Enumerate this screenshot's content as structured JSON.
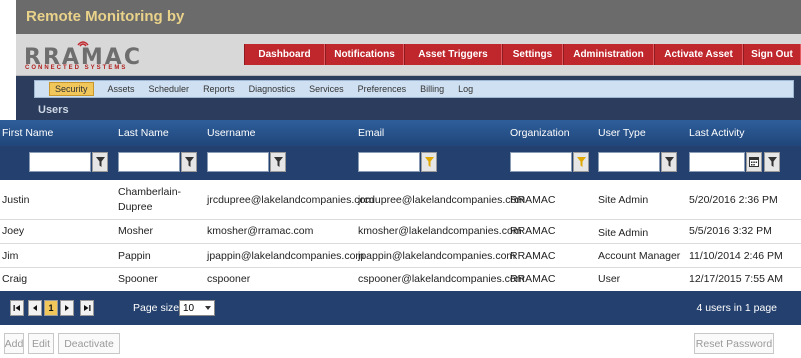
{
  "app": {
    "title": "Remote Monitoring by"
  },
  "logo": {
    "name": "RRAMAC",
    "tagline": "CONNECTED SYSTEMS"
  },
  "mainnav": [
    {
      "label": "Dashboard"
    },
    {
      "label": "Notifications"
    },
    {
      "label": "Asset Triggers"
    },
    {
      "label": "Settings"
    },
    {
      "label": "Administration"
    },
    {
      "label": "Activate Asset"
    },
    {
      "label": "Sign Out"
    }
  ],
  "subtabs": [
    {
      "label": "Security",
      "active": true
    },
    {
      "label": "Assets"
    },
    {
      "label": "Scheduler"
    },
    {
      "label": "Reports"
    },
    {
      "label": "Diagnostics"
    },
    {
      "label": "Services"
    },
    {
      "label": "Preferences"
    },
    {
      "label": "Billing"
    },
    {
      "label": "Log"
    }
  ],
  "section": {
    "title": "Users"
  },
  "grid": {
    "columns": [
      "First Name",
      "Last Name",
      "Username",
      "Email",
      "Organization",
      "User Type",
      "Last Activity"
    ],
    "rows": [
      {
        "first": "Justin",
        "last": "Chamberlain-Dupree",
        "username": "jrcdupree@lakelandcompanies.com",
        "email": "jrcdupree@lakelandcompanies.com",
        "org": "RRAMAC",
        "type": "Site Admin",
        "activity": "5/20/2016 2:36 PM"
      },
      {
        "first": "Joey",
        "last": "Mosher",
        "username": "kmosher@rramac.com",
        "email": "kmosher@lakelandcompanies.com",
        "org": "RRAMAC",
        "type": "Site Admin",
        "activity": "5/5/2016 3:32 PM"
      },
      {
        "first": "Jim",
        "last": "Pappin",
        "username": "jpappin@lakelandcompanies.com",
        "email": "jpappin@lakelandcompanies.com",
        "org": "RRAMAC",
        "type": "Account Manager",
        "activity": "11/10/2014 2:46 PM"
      },
      {
        "first": "Craig",
        "last": "Spooner",
        "username": "cspooner",
        "email": "cspooner@lakelandcompanies.com",
        "org": "RRAMAC",
        "type": "User",
        "activity": "12/17/2015 7:55 AM"
      }
    ]
  },
  "pager": {
    "first_icon": "first-page-icon",
    "prev_icon": "prev-page-icon",
    "current_page": "1",
    "next_icon": "next-page-icon",
    "last_icon": "last-page-icon",
    "page_size_label": "Page size:",
    "page_size_value": "10",
    "summary": "4 users in 1 page"
  },
  "actions": {
    "add": "Add",
    "edit": "Edit",
    "deactivate": "Deactivate",
    "reset_password": "Reset Password"
  },
  "colors": {
    "title_bar": "#6b6b6b",
    "title_text": "#e9d28a",
    "nav_red": "#c0272d",
    "grid_header": "#2e5e9a",
    "filter_row": "#24406e",
    "active_tab": "#f1c75b",
    "active_filter_icon": "#e0a800"
  }
}
